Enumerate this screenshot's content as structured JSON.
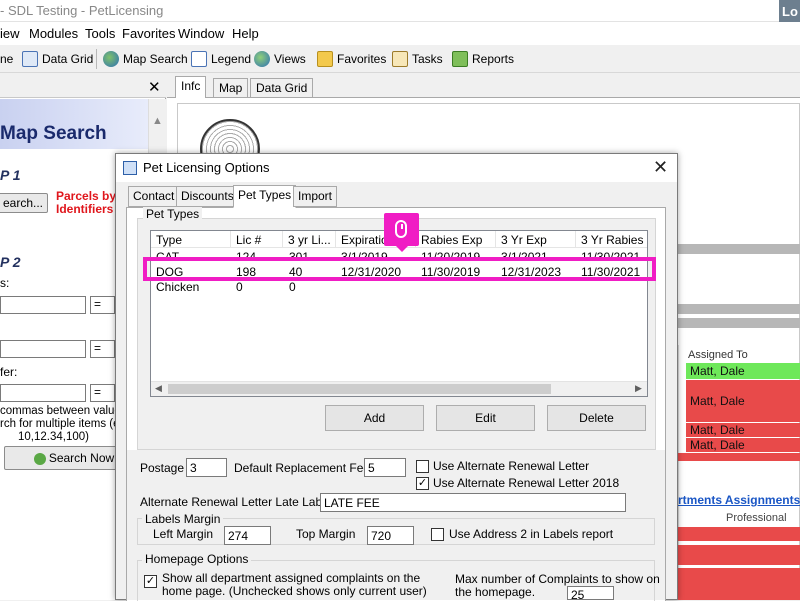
{
  "app": {
    "title": "- SDL Testing - PetLicensing",
    "corner_label": "Lo"
  },
  "menu": [
    "iew",
    "Modules",
    "Tools",
    "Favorites",
    "Window",
    "Help"
  ],
  "toolbar": {
    "items": [
      {
        "label": "ne",
        "icon": "none"
      },
      {
        "label": "Data Grid",
        "icon": "grid-icon"
      },
      {
        "label": "Map Search",
        "icon": "globe-icon"
      },
      {
        "label": "Legend",
        "icon": "legend-icon"
      },
      {
        "label": "Views",
        "icon": "views-icon"
      },
      {
        "label": "Favorites",
        "icon": "star-folder-icon"
      },
      {
        "label": "Tasks",
        "icon": "tasks-icon"
      },
      {
        "label": "Reports",
        "icon": "reports-icon"
      }
    ]
  },
  "left_panel": {
    "close": "✕",
    "title": "Map Search",
    "step1": "P 1",
    "search_button": "earch...",
    "parcels_label": "Parcels by Identifiers",
    "step2": "P 2",
    "field_label_1": "s:",
    "eq": "=",
    "field_label_2": "fer:",
    "hint_line1": "commas between values",
    "hint_line2": "rch for multiple items (ex",
    "hint_line3": "10,12.34,100)",
    "search_now": "Search Now"
  },
  "main": {
    "tabs": [
      "Infc",
      "Map",
      "Data Grid"
    ],
    "assigned_header": "Assigned To",
    "rows": [
      "Matt, Dale",
      "Matt, Dale",
      "Matt, Dale",
      "Matt, Dale"
    ],
    "dept_link": "rtments Assignments",
    "professional": "Professional"
  },
  "dialog": {
    "title": "Pet Licensing Options",
    "close": "✕",
    "tabs": [
      "Contact",
      "Discounts",
      "Pet Types",
      "Import"
    ],
    "selected_tab": "Pet Types",
    "pet_types_group": "Pet Types",
    "columns": [
      "Type",
      "Lic #",
      "3 yr Li...",
      "Expiratio",
      "Rabies Exp",
      "3 Yr  Exp",
      "3 Yr Rabies"
    ],
    "rows": [
      [
        "CAT",
        "124",
        "301",
        "3/1/2019",
        "11/20/2019",
        "3/1/2021",
        "11/30/2021"
      ],
      [
        "DOG",
        "198",
        "40",
        "12/31/2020",
        "11/30/2019",
        "12/31/2023",
        "11/30/2021"
      ],
      [
        "Chicken",
        "0",
        "0",
        "",
        "",
        "",
        ""
      ]
    ],
    "add": "Add",
    "edit": "Edit",
    "delete": "Delete",
    "postage_label": "Postage",
    "postage_value": "3",
    "default_fee_label": "Default Replacement Fee:",
    "default_fee_value": "5",
    "use_alt_label": "Use Alternate Renewal Letter",
    "use_alt_checked": false,
    "use_alt_2018_label": "Use Alternate Renewal Letter 2018",
    "use_alt_2018_checked": true,
    "late_label": "Alternate Renewal Letter Late Label",
    "late_value": "LATE FEE",
    "labels_margin_group": "Labels Margin",
    "left_margin_label": "Left Margin",
    "left_margin_value": "274",
    "top_margin_label": "Top Margin",
    "top_margin_value": "720",
    "use_address2_label": "Use Address 2 in Labels report",
    "use_address2_checked": false,
    "homepage_group": "Homepage Options",
    "show_all_line1": "Show all department assigned complaints on the",
    "show_all_line2": "home page. (Unchecked shows only current user)",
    "show_all_checked": true,
    "max_line1": "Max number of Complaints to show on",
    "max_line2": "the homepage.",
    "max_value": "25"
  },
  "colors": {
    "highlight": "#f01dc4",
    "red_row": "#e84a4a",
    "green_row": "#6ee85a"
  }
}
